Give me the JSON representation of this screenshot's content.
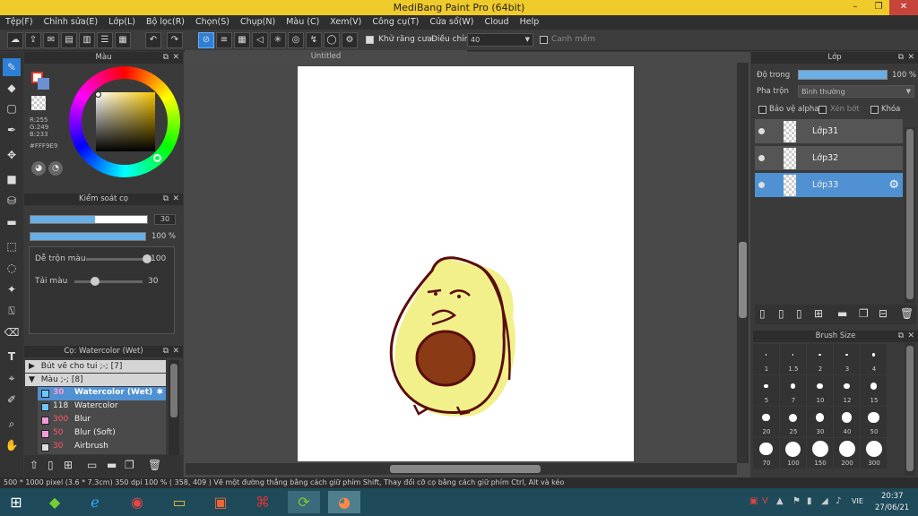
{
  "window": {
    "title": "MediBang Paint Pro (64bit)",
    "min": "–",
    "max": "❐",
    "close": "✕"
  },
  "menu": [
    "Tệp(F)",
    "Chỉnh sửa(E)",
    "Lớp(L)",
    "Bộ lọc(R)",
    "Chọn(S)",
    "Chụp(N)",
    "Màu (C)",
    "Xem(V)",
    "Công cụ(T)",
    "Cửa sổ(W)",
    "Cloud",
    "Help"
  ],
  "toolbar": {
    "antialias_label": "Khử răng cưa",
    "adjust_label": "Điều chỉnh",
    "adjust_value": "40",
    "canh_mem_label": "Canh mềm"
  },
  "color_panel": {
    "title": "Màu",
    "r": "R:255",
    "g": "G:249",
    "b": "B:233",
    "hex": "#FFF9E9",
    "fg_color": "#FFF9E9",
    "bg_color": "#6c8fd1"
  },
  "brush_control": {
    "title": "Kiểm soát cọ",
    "size_value": "30",
    "size_fraction": 0.55,
    "opacity_value": "100 %",
    "opacity_fraction": 1.0,
    "blend_label": "Dễ trộn màu",
    "blend_value": "100",
    "blend_fraction": 1.0,
    "paint_label": "Tải màu",
    "paint_value": "30",
    "paint_fraction": 0.3
  },
  "brush_list": {
    "title": "Cọ: Watercolor (Wet)",
    "groups": [
      {
        "label": "Bút vẽ cho tui ;-; [7]",
        "arrow": "▶"
      },
      {
        "label": "Màu ;-; [8]",
        "arrow": "▼"
      }
    ],
    "brushes": [
      {
        "size": "30",
        "name": "Watercolor (Wet)",
        "color": "#6ec6f5",
        "selected": true
      },
      {
        "size": "118",
        "name": "Watercolor",
        "color": "#6ec6f5",
        "selected": false
      },
      {
        "size": "300",
        "name": "Blur",
        "color": "#f59ad8",
        "selected": false
      },
      {
        "size": "50",
        "name": "Blur (Soft)",
        "color": "#f59ad8",
        "selected": false
      },
      {
        "size": "30",
        "name": "Airbrush",
        "color": "#dddddd",
        "selected": false
      }
    ]
  },
  "canvas": {
    "tab_title": "Untitled"
  },
  "layer_panel": {
    "title": "Lớp",
    "opacity_label": "Độ trong",
    "opacity_value": "100 %",
    "blend_label": "Pha trộn",
    "blend_value": "Bình thường",
    "protect_alpha": "Bảo vệ alpha",
    "clip": "Xén bớt",
    "lock": "Khóa",
    "layers": [
      {
        "name": "Lớp31",
        "selected": false
      },
      {
        "name": "Lớp32",
        "selected": false
      },
      {
        "name": "Lớp33",
        "selected": true
      }
    ]
  },
  "brush_size_panel": {
    "title": "Brush Size",
    "sizes": [
      "1",
      "1.5",
      "2",
      "3",
      "4",
      "5",
      "7",
      "10",
      "12",
      "15",
      "20",
      "25",
      "30",
      "40",
      "50",
      "70",
      "100",
      "150",
      "200",
      "300"
    ]
  },
  "status": {
    "text": "500 * 1000 pixel   (3.6 * 7.3cm)   350 dpi   100 %   ( 358, 409 )   Vẽ một đường thẳng bằng cách giữ phím Shift, Thay đổi cỡ cọ bằng cách giữ phím Ctrl, Alt và kéo"
  },
  "taskbar": {
    "lang": "VIE",
    "time": "20:37",
    "date": "27/06/21"
  }
}
